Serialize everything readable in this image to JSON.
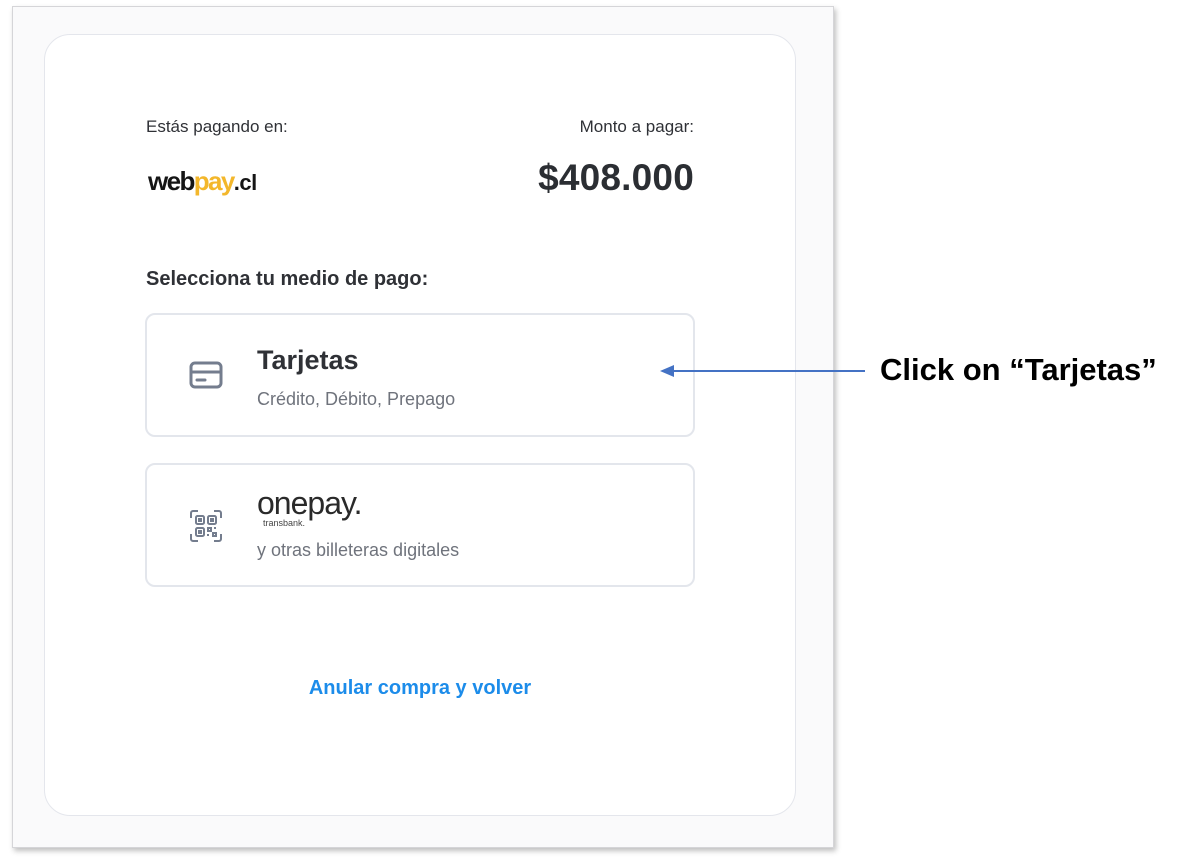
{
  "payment": {
    "paying_at_label": "Estás pagando en:",
    "amount_label": "Monto a pagar:",
    "amount": "$408.000",
    "logo": {
      "part1": "web",
      "part2": "pay",
      "part3": ".cl"
    },
    "select_label": "Selecciona tu medio de pago:"
  },
  "options": [
    {
      "title": "Tarjetas",
      "subtitle": "Crédito, Débito, Prepago",
      "icon": "credit-card-icon"
    },
    {
      "brand": "onepay.",
      "brand_sub": "transbank.",
      "subtitle": "y otras billeteras digitales",
      "icon": "qr-code-icon"
    }
  ],
  "cancel_link": "Anular compra y volver",
  "annotation": {
    "text": "Click on “Tarjetas”",
    "arrow_color": "#4472c4"
  },
  "colors": {
    "accent_link": "#1c8cea",
    "logo_yellow": "#f3b72b"
  }
}
